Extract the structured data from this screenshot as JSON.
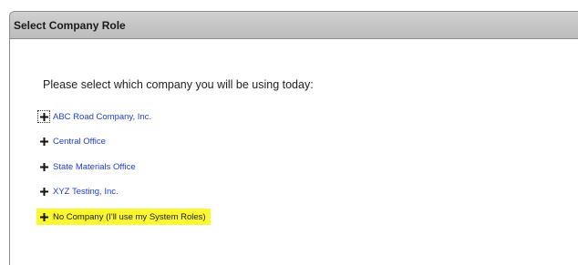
{
  "panel": {
    "title": "Select Company Role"
  },
  "prompt": "Please select which company you will be using today:",
  "companies": [
    {
      "label": "ABC Road Company, Inc.",
      "icon": "plus-icon",
      "focused": true,
      "highlighted": false
    },
    {
      "label": "Central Office",
      "icon": "plus-icon",
      "focused": false,
      "highlighted": false
    },
    {
      "label": "State Materials Office",
      "icon": "plus-icon",
      "focused": false,
      "highlighted": false
    },
    {
      "label": "XYZ Testing, Inc.",
      "icon": "plus-icon",
      "focused": false,
      "highlighted": false
    },
    {
      "label": "No Company (I'll use my System Roles)",
      "icon": "plus-icon",
      "focused": false,
      "highlighted": true
    }
  ],
  "colors": {
    "link": "#1f3fcf",
    "highlight": "#fbf832",
    "header_bg": "#c8c8c8"
  }
}
